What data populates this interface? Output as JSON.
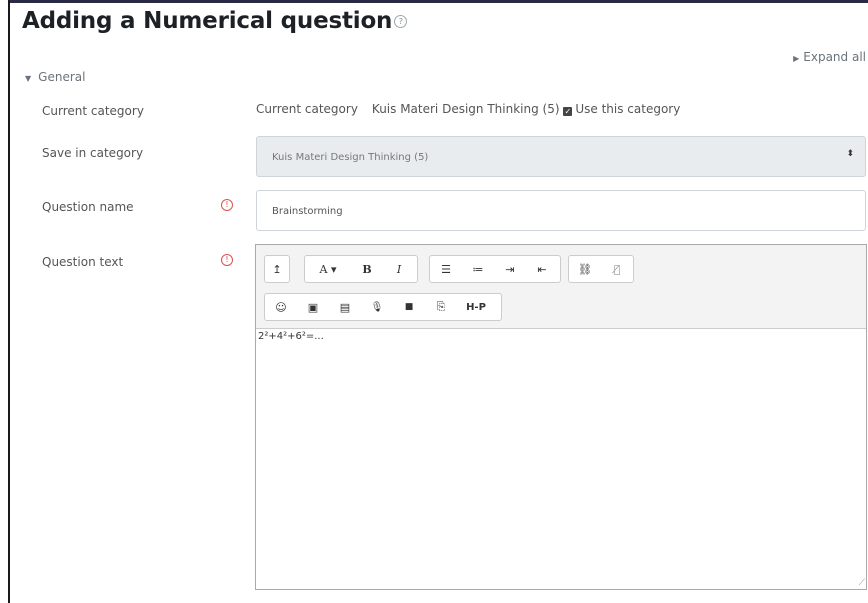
{
  "page": {
    "title": "Adding a Numerical question",
    "help_icon": "question-circle-icon",
    "expand_all": "Expand all"
  },
  "section": {
    "label": "General",
    "state": "expanded"
  },
  "current_category": {
    "label": "Current category",
    "caption": "Current category",
    "value": "Kuis Materi Design Thinking (5)",
    "checkbox_label": "Use this category",
    "checked": true
  },
  "save_in_category": {
    "label": "Save in category",
    "selected": "Kuis Materi Design Thinking (5)"
  },
  "question_name": {
    "label": "Question name",
    "value": "Brainstorming",
    "required_icon": "exclamation-circle-icon"
  },
  "question_text": {
    "label": "Question text",
    "required_icon": "exclamation-circle-icon",
    "content": "2²+4²+6²=...",
    "toolbar": {
      "row1": {
        "collapse": "↥",
        "font_color": "A ▾",
        "bold": "B",
        "italic": "I",
        "unordered_list": "☰",
        "ordered_list": "≔",
        "indent": "⇥",
        "outdent": "⇤",
        "link": "⛓",
        "unlink": "⛓̸"
      },
      "row2": {
        "emoji": "☺",
        "image": "▣",
        "media": "▤",
        "record_audio": "🎙",
        "record_video": "■",
        "manage_files": "⎘",
        "h5p": "H-P"
      }
    }
  },
  "colors": {
    "required": "#d9534f",
    "select_bg": "#e9ecef",
    "toolbar_bg": "#f3f3f3"
  }
}
